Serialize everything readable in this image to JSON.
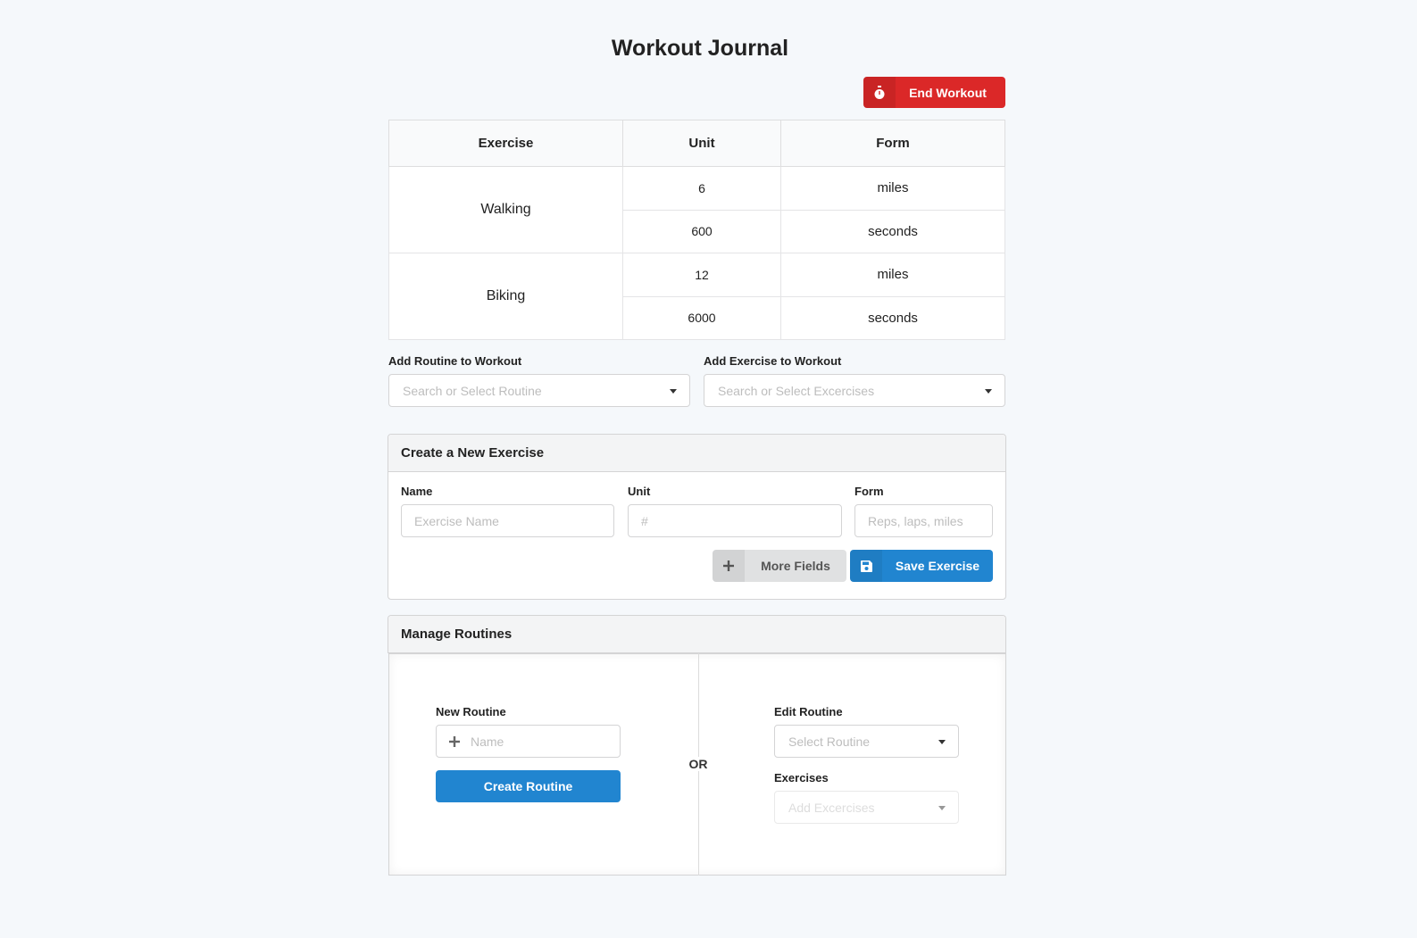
{
  "page": {
    "title": "Workout Journal"
  },
  "end_workout": {
    "label": "End Workout",
    "icon": "stopwatch-icon"
  },
  "journal": {
    "headers": [
      "Exercise",
      "Unit",
      "Form"
    ],
    "rows": [
      {
        "exercise": "Walking",
        "sets": [
          {
            "unit": "6",
            "form": "miles"
          },
          {
            "unit": "600",
            "form": "seconds"
          }
        ]
      },
      {
        "exercise": "Biking",
        "sets": [
          {
            "unit": "12",
            "form": "miles"
          },
          {
            "unit": "6000",
            "form": "seconds"
          }
        ]
      }
    ]
  },
  "add_routine": {
    "label": "Add Routine to Workout",
    "placeholder": "Search or Select Routine"
  },
  "add_exercise": {
    "label": "Add Exercise to Workout",
    "placeholder": "Search or Select Excercises"
  },
  "create_exercise": {
    "heading": "Create a New Exercise",
    "name_label": "Name",
    "name_placeholder": "Exercise Name",
    "unit_label": "Unit",
    "unit_placeholder": "#",
    "form_label": "Form",
    "form_placeholder": "Reps, laps, miles",
    "more_fields": "More Fields",
    "save": "Save Exercise"
  },
  "manage_routines": {
    "heading": "Manage Routines",
    "new_routine_label": "New Routine",
    "new_routine_placeholder": "Name",
    "create_button": "Create Routine",
    "or": "OR",
    "edit_routine_label": "Edit Routine",
    "edit_routine_placeholder": "Select Routine",
    "exercises_label": "Exercises",
    "exercises_placeholder": "Add Excercises"
  },
  "colors": {
    "danger": "#db2828",
    "primary": "#2185d0",
    "background": "#f5f8fb"
  }
}
